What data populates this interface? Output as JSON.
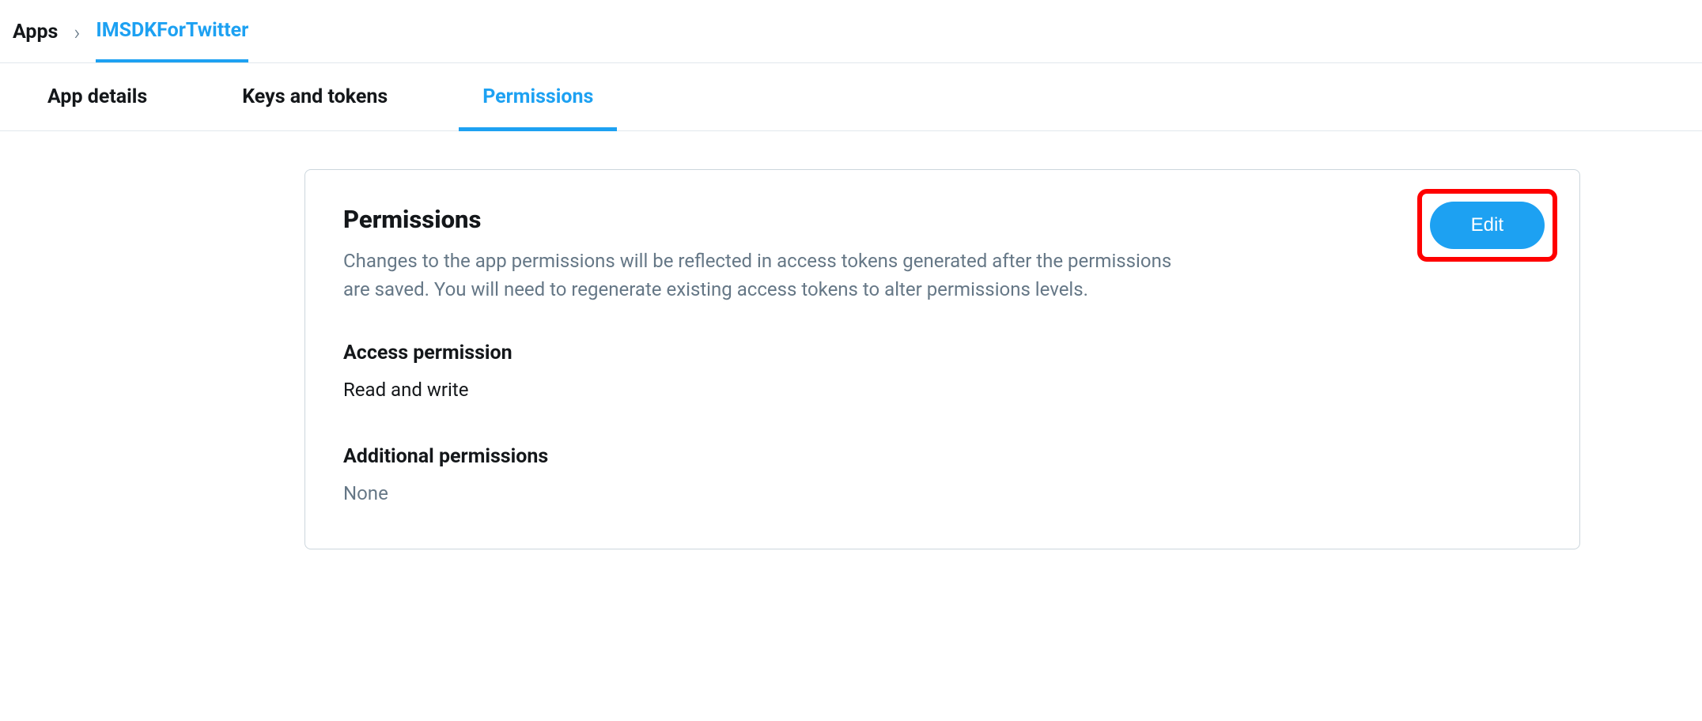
{
  "breadcrumb": {
    "root": "Apps",
    "current": "IMSDKForTwitter"
  },
  "tabs": [
    {
      "label": "App details",
      "active": false
    },
    {
      "label": "Keys and tokens",
      "active": false
    },
    {
      "label": "Permissions",
      "active": true
    }
  ],
  "card": {
    "title": "Permissions",
    "description": "Changes to the app permissions will be reflected in access tokens generated after the permissions are saved. You will need to regenerate existing access tokens to alter permissions levels.",
    "edit_label": "Edit",
    "sections": {
      "access": {
        "title": "Access permission",
        "value": "Read and write"
      },
      "additional": {
        "title": "Additional permissions",
        "value": "None"
      }
    }
  }
}
